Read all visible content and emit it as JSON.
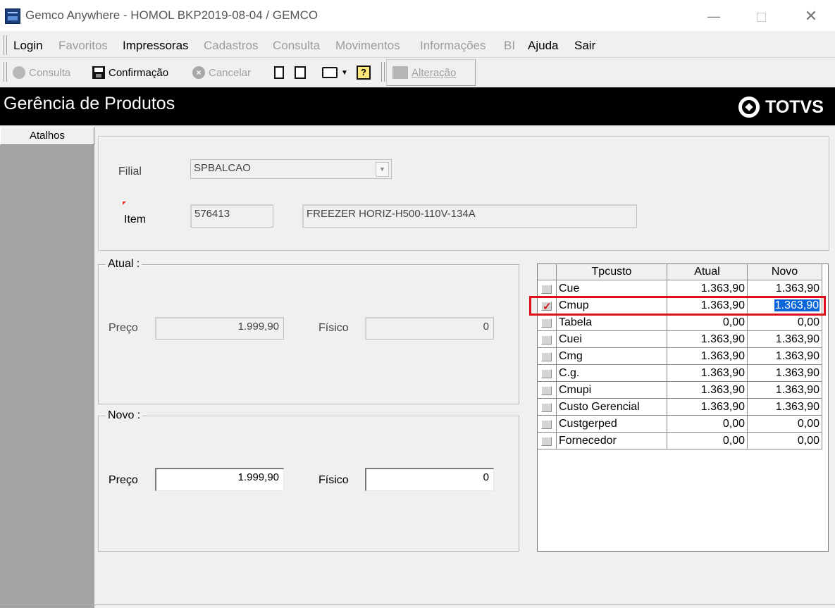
{
  "window": {
    "title": "Gemco Anywhere - HOMOL BKP2019-08-04 / GEMCO",
    "minimize": "—",
    "close": "✕"
  },
  "menu": {
    "items": [
      {
        "label": "Login",
        "enabled": true
      },
      {
        "label": "Favoritos",
        "enabled": false
      },
      {
        "label": "Impressoras",
        "enabled": true
      },
      {
        "label": "Cadastros",
        "enabled": false
      },
      {
        "label": "Consulta",
        "enabled": false
      },
      {
        "label": "Movimentos",
        "enabled": false
      },
      {
        "label": "Informações",
        "enabled": false
      },
      {
        "label": "BI",
        "enabled": false
      },
      {
        "label": "Ajuda",
        "enabled": true
      },
      {
        "label": "Sair",
        "enabled": true
      }
    ]
  },
  "toolbar": {
    "consulta": "Consulta",
    "confirmacao": "Confirmação",
    "cancelar": "Cancelar",
    "alteracao": "Alteração",
    "help_glyph": "?"
  },
  "header": {
    "title": "Gerência de Produtos",
    "brand": "TOTVS"
  },
  "sidebar": {
    "atalhos": "Atalhos"
  },
  "form": {
    "filial_label": "Filial",
    "filial_value": "SPBALCAO",
    "item_label": "Item",
    "item_code": "576413",
    "item_desc": "FREEZER HORIZ-H500-110V-134A"
  },
  "atual": {
    "legend": "Atual :",
    "preco_label": "Preço",
    "preco_value": "1.999,90",
    "fisico_label": "Físico",
    "fisico_value": "0"
  },
  "novo": {
    "legend": "Novo :",
    "preco_label": "Preço",
    "preco_value": "1.999,90",
    "fisico_label": "Físico",
    "fisico_value": "0"
  },
  "grid": {
    "headers": [
      "Tpcusto",
      "Atual",
      "Novo"
    ],
    "rows": [
      {
        "tpcusto": "Cue",
        "atual": "1.363,90",
        "novo": "1.363,90",
        "checked": false
      },
      {
        "tpcusto": "Cmup",
        "atual": "1.363,90",
        "novo": "1.363,90",
        "checked": true
      },
      {
        "tpcusto": "Tabela",
        "atual": "0,00",
        "novo": "0,00",
        "checked": false
      },
      {
        "tpcusto": "Cuei",
        "atual": "1.363,90",
        "novo": "1.363,90",
        "checked": false
      },
      {
        "tpcusto": "Cmg",
        "atual": "1.363,90",
        "novo": "1.363,90",
        "checked": false
      },
      {
        "tpcusto": "C.g.",
        "atual": "1.363,90",
        "novo": "1.363,90",
        "checked": false
      },
      {
        "tpcusto": "Cmupi",
        "atual": "1.363,90",
        "novo": "1.363,90",
        "checked": false
      },
      {
        "tpcusto": "Custo Gerencial",
        "atual": "1.363,90",
        "novo": "1.363,90",
        "checked": false
      },
      {
        "tpcusto": "Custgerped",
        "atual": "0,00",
        "novo": "0,00",
        "checked": false
      },
      {
        "tpcusto": "Fornecedor",
        "atual": "0,00",
        "novo": "0,00",
        "checked": false
      }
    ]
  }
}
